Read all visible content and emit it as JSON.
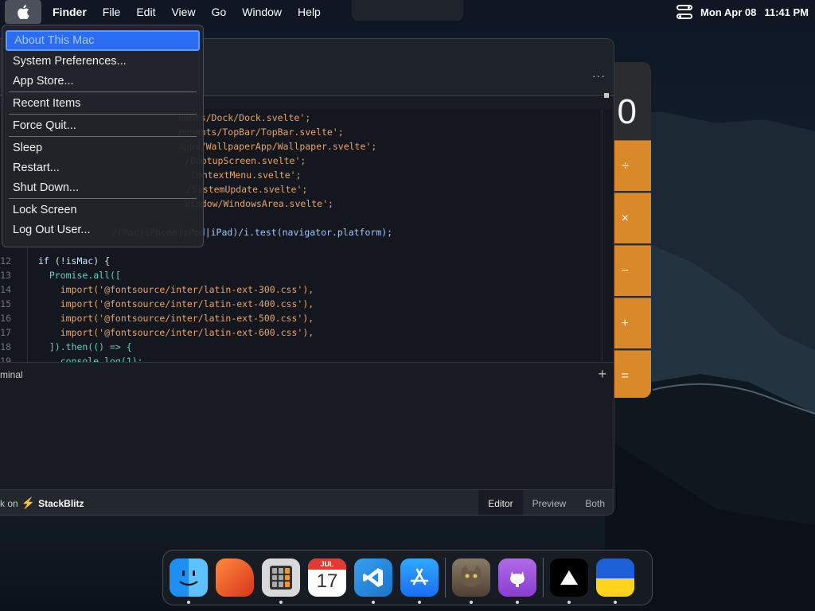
{
  "menubar": {
    "app_name": "Finder",
    "menus": [
      "File",
      "Edit",
      "View",
      "Go",
      "Window",
      "Help"
    ],
    "date": "Mon Apr 08",
    "time": "11:41 PM"
  },
  "apple_menu": {
    "items": [
      "About This Mac",
      "System Preferences...",
      "App Store...",
      "Recent Items",
      "Force Quit...",
      "Sleep",
      "Restart...",
      "Shut Down...",
      "Lock Screen",
      "Log Out User..."
    ]
  },
  "calculator": {
    "display": "0",
    "keys": [
      "÷",
      "×",
      "−",
      "+",
      "="
    ]
  },
  "editor": {
    "dots": "···",
    "lines": [
      {
        "n": "",
        "code": "nents/Dock/Dock.svelte';"
      },
      {
        "n": "",
        "code": "ponents/TopBar/TopBar.svelte';"
      },
      {
        "n": "",
        "code": "Apps/WallpaperApp/Wallpaper.svelte';"
      },
      {
        "n": "",
        "code": "/BootupScreen.svelte';"
      },
      {
        "n": "",
        "code": "ContextMenu.svelte';"
      },
      {
        "n": "",
        "code": "/SystemUpdate.svelte';"
      },
      {
        "n": "",
        "code": "Window/WindowsArea.svelte';"
      },
      {
        "n": "",
        "code": ""
      },
      {
        "n": "",
        "code": "/(Mac|iPhone|iPod|iPad)/i.test(navigator.platform);"
      },
      {
        "n": "",
        "code": ""
      },
      {
        "n": "12",
        "code": "if (!isMac) {"
      },
      {
        "n": "13",
        "code": "  Promise.all(["
      },
      {
        "n": "14",
        "code": "    import('@fontsource/inter/latin-ext-300.css'),"
      },
      {
        "n": "15",
        "code": "    import('@fontsource/inter/latin-ext-400.css'),"
      },
      {
        "n": "16",
        "code": "    import('@fontsource/inter/latin-ext-500.css'),"
      },
      {
        "n": "17",
        "code": "    import('@fontsource/inter/latin-ext-600.css'),"
      },
      {
        "n": "18",
        "code": "  ]).then(() => {"
      },
      {
        "n": "19",
        "code": "    console.log(1);"
      }
    ],
    "terminal_label": "rminal",
    "terminal_add": "+",
    "footer_prefix": "rk on",
    "footer_brand": "StackBlitz",
    "view_tabs": [
      "Editor",
      "Preview",
      "Both"
    ],
    "active_view": "Editor"
  },
  "dock": {
    "apps": [
      {
        "name": "Finder",
        "running": true
      },
      {
        "name": "Microsoft Office",
        "running": false
      },
      {
        "name": "Calculator",
        "running": true
      },
      {
        "name": "Calendar",
        "running": false,
        "month": "JUL",
        "day": "17"
      },
      {
        "name": "VS Code",
        "running": true
      },
      {
        "name": "App Store",
        "running": true
      },
      {
        "name": "Cat",
        "running": true
      },
      {
        "name": "GitHub",
        "running": true
      },
      {
        "name": "Vercel",
        "running": true
      },
      {
        "name": "Ukraine",
        "running": true
      }
    ]
  },
  "colors": {
    "accent": "#2a6df2",
    "calculator_key": "#d9892a"
  }
}
